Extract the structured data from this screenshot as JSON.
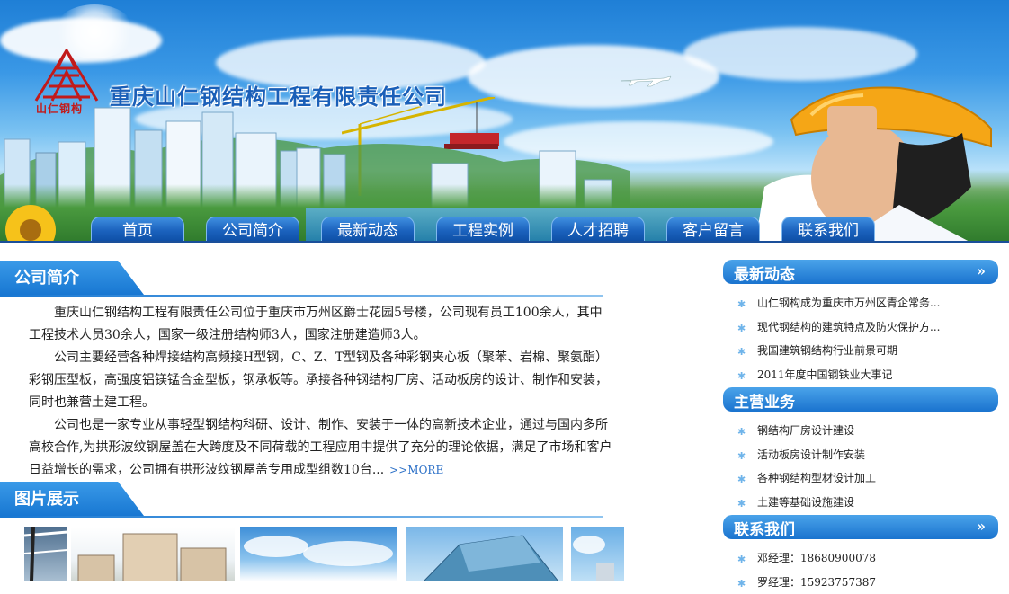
{
  "header": {
    "company_name": "重庆山仁钢结构工程有限责任公司",
    "logo_text": "山仁钢构"
  },
  "nav": {
    "items": [
      {
        "label": "首页"
      },
      {
        "label": "公司简介"
      },
      {
        "label": "最新动态"
      },
      {
        "label": "工程实例"
      },
      {
        "label": "人才招聘"
      },
      {
        "label": "客户留言"
      },
      {
        "label": "联系我们"
      }
    ]
  },
  "main": {
    "intro_title": "公司简介",
    "intro_paragraphs": [
      "重庆山仁钢结构工程有限责任公司位于重庆市万州区爵士花园5号楼，公司现有员工100余人，其中工程技术人员30余人，国家一级注册结构师3人，国家注册建造师3人。",
      "公司主要经营各种焊接结构高频接H型钢，C、Z、T型钢及各种彩钢夹心板（聚苯、岩棉、聚氨酯） 彩钢压型板，高强度铝镁锰合金型板，钢承板等。承接各种钢结构厂房、活动板房的设计、制作和安装，同时也兼营土建工程。",
      "公司也是一家专业从事轻型钢结构科研、设计、制作、安装于一体的高新技术企业，通过与国内多所高校合作,为拱形波纹钢屋盖在大跨度及不同荷载的工程应用中提供了充分的理论依据，满足了市场和客户日益增长的需求，公司拥有拱形波纹钢屋盖专用成型组数10台..."
    ],
    "more_label": ">>MORE",
    "gallery_title": "图片展示"
  },
  "sidebar": {
    "news": {
      "title": "最新动态",
      "arrow": "»",
      "items": [
        "山仁钢构成为重庆市万州区青企常务...",
        "现代钢结构的建筑特点及防火保护方...",
        "我国建筑钢结构行业前景可期",
        "2011年度中国钢铁业大事记"
      ]
    },
    "business": {
      "title": "主营业务",
      "items": [
        "钢结构厂房设计建设",
        "活动板房设计制作安装",
        "各种钢结构型材设计加工",
        "土建等基础设施建设"
      ]
    },
    "contact": {
      "title": "联系我们",
      "arrow": "»",
      "items": [
        "邓经理：18680900078",
        "罗经理：15923757387"
      ]
    }
  }
}
